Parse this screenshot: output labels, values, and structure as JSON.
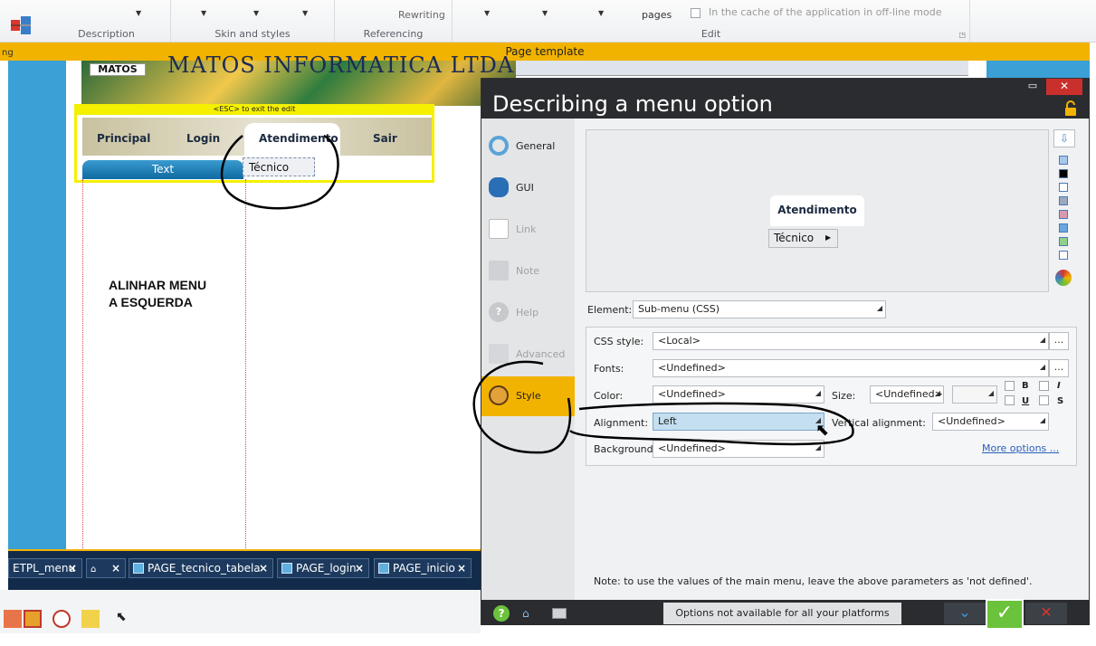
{
  "ribbon": {
    "rewriting": "Rewriting",
    "pages": "pages",
    "offline": "In the cache of the application in off-line mode",
    "groups": [
      "Description",
      "Skin and styles",
      "Referencing",
      "Edit"
    ]
  },
  "template_bar": {
    "title": "Page template",
    "left_fragment": "ng"
  },
  "canvas": {
    "banner_title": "MATOS INFORMATICA LTDA",
    "logo": "MATOS",
    "esc_hint": "<ESC> to exit the edit",
    "menu": [
      "Principal",
      "Login",
      "Atendimento",
      "Sair"
    ],
    "text_bar": "Text",
    "submenu": "Técnico",
    "annotation_line1": "ALINHAR MENU",
    "annotation_line2": "A ESQUERDA"
  },
  "tabs": [
    {
      "label": "ETPL_menu"
    },
    {
      "label": ""
    },
    {
      "label": "PAGE_tecnico_tabela"
    },
    {
      "label": "PAGE_login"
    },
    {
      "label": "PAGE_inicio"
    }
  ],
  "dialog": {
    "title": "Describing a menu option",
    "sidebar": [
      {
        "label": "General",
        "icon": "ring-icon"
      },
      {
        "label": "GUI",
        "icon": "eye-icon"
      },
      {
        "label": "Link",
        "icon": "link-icon"
      },
      {
        "label": "Note",
        "icon": "note-icon"
      },
      {
        "label": "Help",
        "icon": "help-icon"
      },
      {
        "label": "Advanced",
        "icon": "advanced-icon"
      },
      {
        "label": "Style",
        "icon": "palette-icon"
      }
    ],
    "preview": {
      "menu_item": "Atendimento",
      "submenu_item": "Técnico"
    },
    "element_label": "Element:",
    "element_value": "Sub-menu (CSS)",
    "css_style_label": "CSS style:",
    "css_style_value": "<Local>",
    "fonts_label": "Fonts:",
    "fonts_value": "<Undefined>",
    "color_label": "Color:",
    "color_value": "<Undefined>",
    "size_label": "Size:",
    "size_value": "<Undefined>",
    "bold": "B",
    "italic": "I",
    "underline": "U",
    "strike": "S",
    "alignment_label": "Alignment:",
    "alignment_value": "Left",
    "valign_label": "Vertical alignment:",
    "valign_value": "<Undefined>",
    "background_label": "Background:",
    "background_value": "<Undefined>",
    "more_options": "More options ...",
    "dots": "...",
    "note": "Note: to use the values of the main menu, leave the above parameters as 'not defined'.",
    "platform_note": "Options not available for all your platforms"
  },
  "colors": {
    "accent": "#f2b300",
    "dialog_dark": "#2b2c30",
    "ok_green": "#6bc23b",
    "close_red": "#c9302c",
    "canvas_blue": "#3aa0d6",
    "alignment_highlight": "#c4dff0"
  }
}
